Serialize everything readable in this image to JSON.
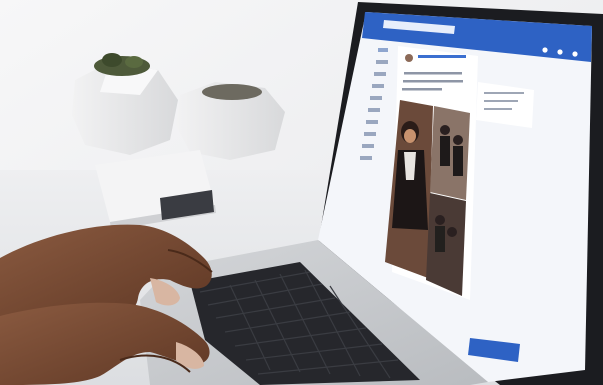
{
  "scene": {
    "description_colors": {
      "background": "#f1f2f4",
      "plant_pot": "#e9e9ea",
      "laptop_bezel": "#1b1c20",
      "laptop_body": "#c9cbce",
      "screen_header": "#2e62c4",
      "screen_bg": "#f4f6fa",
      "skin": "#7a4a33"
    },
    "icons": [
      "plant-pot",
      "laptop",
      "hands",
      "social-feed-screen",
      "notification-badge"
    ]
  },
  "screen": {
    "app_color": "#3b6fd0",
    "sidebar_items": 10,
    "chat_bar_color": "#2e62c4"
  }
}
